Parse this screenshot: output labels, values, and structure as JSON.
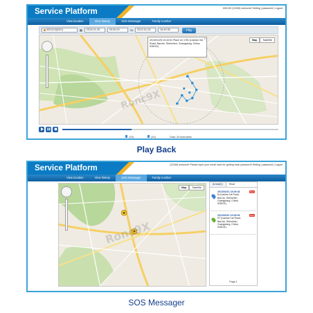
{
  "top_panel": {
    "brand_title": "Service Platform",
    "user_bar": "600130 (12345) welcome! Setting | password | Logout",
    "nav_tabs": [
      {
        "label": "View location",
        "active": false
      },
      {
        "label": "View history",
        "active": true
      },
      {
        "label": "SOS Messager",
        "active": false
      },
      {
        "label": "Family number",
        "active": false
      }
    ],
    "controls": {
      "device_select": "5001013(0001)",
      "from_date": "2013-01-25",
      "from_time": "00:00:00",
      "to_label": "To",
      "to_date": "2013-01-25",
      "to_time": "16:49:35",
      "play_button": "Play"
    },
    "map_types": [
      "Map",
      "Satellite"
    ],
    "info_bubble": "2013/01/25 10:43:51 Place on 1781 (Lianlan 3rd Road, Bao'an, Shenzhen, Guangdong, China, 518101)",
    "playback_legend": [
      {
        "label": "(10)",
        "color": "#3b8fd6"
      },
      {
        "label": "(10)",
        "color": "#3b8fd6"
      },
      {
        "label": "Total: 20 footmarks",
        "color": ""
      }
    ],
    "progress_fraction": 0.32,
    "caption": "Play Back"
  },
  "bottom_panel": {
    "brand_title": "Service Platform",
    "user_bar": "(12345) welcome! Please input your email used for getting back password! Setting | password | Logout",
    "nav_tabs": [
      {
        "label": "View location",
        "active": false
      },
      {
        "label": "View history",
        "active": false
      },
      {
        "label": "SOS Messager",
        "active": true
      },
      {
        "label": "Family number",
        "active": false
      }
    ],
    "map_types": [
      "Map",
      "Satellite"
    ],
    "alarm_tabs": [
      "Arrival(2)",
      "Read"
    ],
    "alarms": [
      {
        "time": "2013/02/21 13:06:33",
        "address": "B (Lianlan 1st Road, Bao'an, Shenzhen, Guangdong, China, 518101)",
        "badge": "New",
        "pin_color": "#3b7fd6"
      },
      {
        "time": "2013/02/21 13:06:04",
        "address": "ST (Lianlan 1st Road, Bao'an, Shenzhen, Guangdong, China, 518101)",
        "badge": "New",
        "pin_color": "#67b02f"
      }
    ],
    "page_label": "Page 1",
    "caption": "SOS Messager"
  },
  "colors": {
    "brand": "#0a7bc4",
    "brand_stripe": "#f0b22a",
    "nav": "#1b74b8",
    "frame": "#3aa2d8",
    "caption": "#123c8a",
    "alarm_badge": "#e13a2d"
  }
}
